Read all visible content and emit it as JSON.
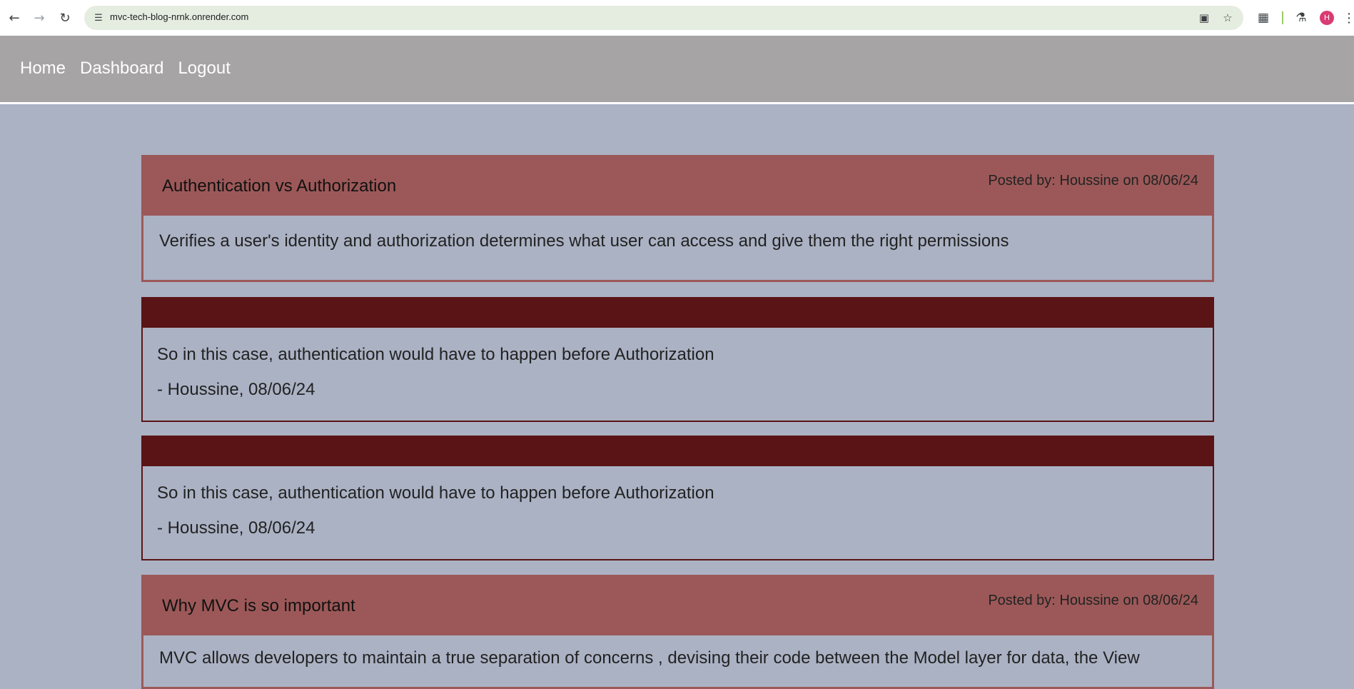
{
  "browser": {
    "url": "mvc-tech-blog-nrnk.onrender.com",
    "avatar_letter": "H"
  },
  "nav": {
    "home": "Home",
    "dashboard": "Dashboard",
    "logout": "Logout"
  },
  "posts": [
    {
      "title": "Authentication vs Authorization",
      "meta": "Posted by: Houssine on 08/06/24",
      "body": "Verifies a user's identity and authorization determines what user can access and give them the right permissions"
    },
    {
      "title": "Why MVC is so important",
      "meta": "Posted by: Houssine on 08/06/24",
      "body": "MVC allows developers to maintain a true separation of concerns , devising their code between the Model layer for data, the View"
    }
  ],
  "comments": [
    {
      "text": "So in this case, authentication would have to happen before Authorization",
      "author": "- Houssine, 08/06/24"
    },
    {
      "text": "So in this case, authentication would have to happen before Authorization",
      "author": "- Houssine, 08/06/24"
    }
  ],
  "colors": {
    "page_bg": "#abb2c4",
    "header_bg": "#a6a4a5",
    "post_header": "#9c5858",
    "comment_header": "#5a1416"
  }
}
